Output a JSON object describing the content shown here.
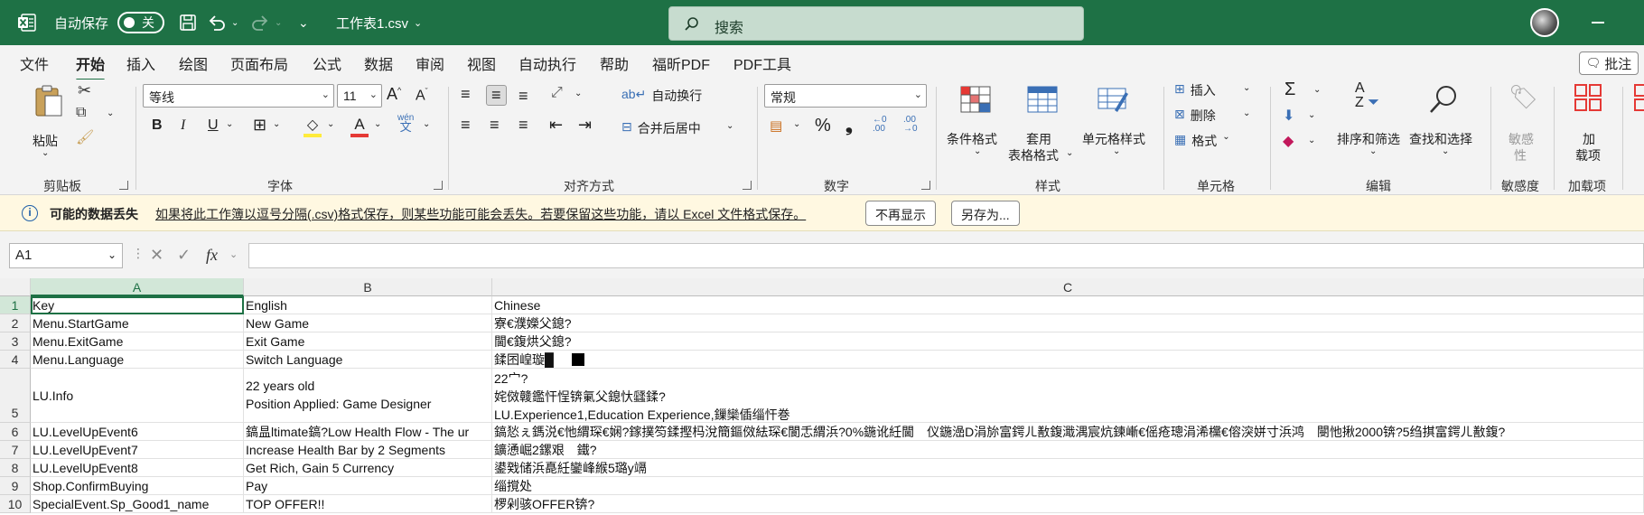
{
  "titlebar": {
    "autosave_label": "自动保存",
    "autosave_state": "关",
    "doc_title": "工作表1.csv",
    "search_placeholder": "搜索"
  },
  "tabs": [
    "文件",
    "开始",
    "插入",
    "绘图",
    "页面布局",
    "公式",
    "数据",
    "审阅",
    "视图",
    "自动执行",
    "帮助",
    "福昕PDF",
    "PDF工具"
  ],
  "active_tab": "开始",
  "comment_button": "批注",
  "ribbon": {
    "clipboard": {
      "paste": "粘贴",
      "label": "剪贴板"
    },
    "font": {
      "name": "等线",
      "size": "11",
      "label": "字体"
    },
    "alignment": {
      "wrap": "自动换行",
      "merge": "合并后居中",
      "label": "对齐方式"
    },
    "number": {
      "format": "常规",
      "label": "数字"
    },
    "styles": {
      "conditional": "条件格式",
      "table_line1": "套用",
      "table_line2": "表格格式",
      "cell_styles": "单元格样式",
      "label": "样式"
    },
    "cells": {
      "insert": "插入",
      "delete": "删除",
      "format": "格式",
      "label": "单元格"
    },
    "editing": {
      "sort": "排序和筛选",
      "find": "查找和选择",
      "label": "编辑"
    },
    "sensitivity": {
      "line1": "敏感",
      "line2": "性",
      "label": "敏感度"
    },
    "addins": {
      "line1": "加",
      "line2": "载项",
      "label": "加载项"
    }
  },
  "message_bar": {
    "title": "可能的数据丢失",
    "text": "如果将此工作簿以逗号分隔(.csv)格式保存，则某些功能可能会丢失。若要保留这些功能，请以 Excel 文件格式保存。",
    "dont_show": "不再显示",
    "save_as": "另存为..."
  },
  "formula_bar": {
    "name_box": "A1",
    "formula": ""
  },
  "columns": [
    "A",
    "B",
    "C"
  ],
  "rows": [
    {
      "num": "1",
      "a": "Key",
      "b": "English",
      "c": "Chinese"
    },
    {
      "num": "2",
      "a": "Menu.StartGame",
      "b": "New Game",
      "c": "寮€濮嬫父鎴?"
    },
    {
      "num": "3",
      "a": "Menu.ExitGame",
      "b": "Exit Game",
      "c": "閫€鍑烘父鎴?"
    },
    {
      "num": "4",
      "a": "Menu.Language",
      "b": "Switch Language",
      "c": "鍒囨崲璇█"
    },
    {
      "num": "5",
      "a": "LU.Info",
      "b": "22 years old\nPosition Applied: Game Designer",
      "c": "22宀?\n姹傚竷鑑忓悜锛氭父鎴忕瓥鍒?\nLU.Experience1,Education Experience,鏁欒偛缁忓巻"
    },
    {
      "num": "6",
      "a": "LU.LevelUpEvent6",
      "b": "鎬昷ltimate鎬?Low Health Flow - The ur",
      "c": "鎬悐ぇ鎷涚€忚緭琛€娴?鎵撲笉鍒摼杩涗簡鏂傚紶琛€閬忎緭浜?0%鍦讹紝閫　仪鍦澏D涓旀富鍔ㄦ敾鍑濈湡宸炕鍊嶃€傜疮璁涓浠欓€傛湥姘寸浜鸿　閿忚揪2000锛?5绉掑富鍔ㄦ敾鍑?"
    },
    {
      "num": "7",
      "a": "LU.LevelUpEvent7",
      "b": "Increase Health Bar by 2 Segments",
      "c": "鑛慂崛2鏍艰　鐵?"
    },
    {
      "num": "8",
      "a": "LU.LevelUpEvent8",
      "b": "Get Rich, Gain 5 Currency",
      "c": "鍙戣储浜嗭紝鑾峰緱5璐у竵"
    },
    {
      "num": "9",
      "a": "Shop.ConfirmBuying",
      "b": "Pay",
      "c": "缁撹处"
    },
    {
      "num": "10",
      "a": "SpecialEvent.Sp_Good1_name",
      "b": "TOP OFFER!!",
      "c": "椤剁骇OFFER锛?"
    }
  ]
}
